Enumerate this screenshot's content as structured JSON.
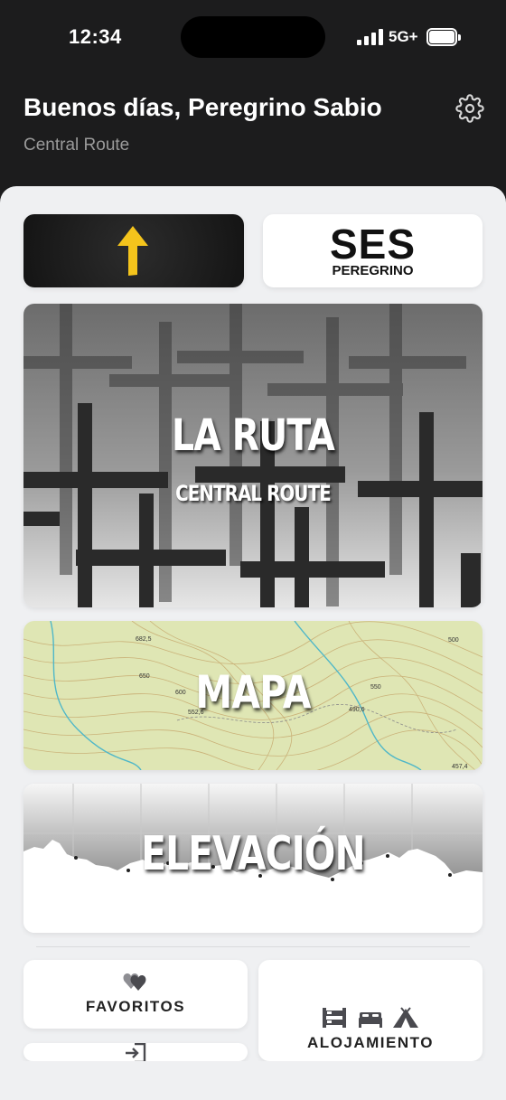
{
  "status": {
    "time": "12:34",
    "network": "5G+"
  },
  "header": {
    "greeting": "Buenos días, Peregrino Sabio",
    "route": "Central Route"
  },
  "cards": {
    "ses": {
      "title": "SES",
      "subtitle": "PEREGRINO"
    },
    "ruta": {
      "title": "LA RUTA",
      "subtitle": "CENTRAL ROUTE"
    },
    "mapa": {
      "title": "MAPA",
      "labels": [
        "682,5",
        "650",
        "600",
        "552,6",
        "490,6",
        "550",
        "500",
        "457,4"
      ]
    },
    "elevacion": {
      "title": "ELEVACIÓN"
    }
  },
  "tiles": {
    "favoritos": "FAVORITOS",
    "alojamiento": "ALOJAMIENTO"
  },
  "colors": {
    "accent_yellow": "#f4c41c",
    "header_bg": "#1c1c1d",
    "sheet_bg": "#eff0f2"
  },
  "icons": [
    "signal-icon",
    "battery-icon",
    "gear-icon",
    "arrow-up-icon",
    "hearts-icon",
    "bunk-bed-icon",
    "bed-icon",
    "tent-icon",
    "sign-in-icon"
  ]
}
